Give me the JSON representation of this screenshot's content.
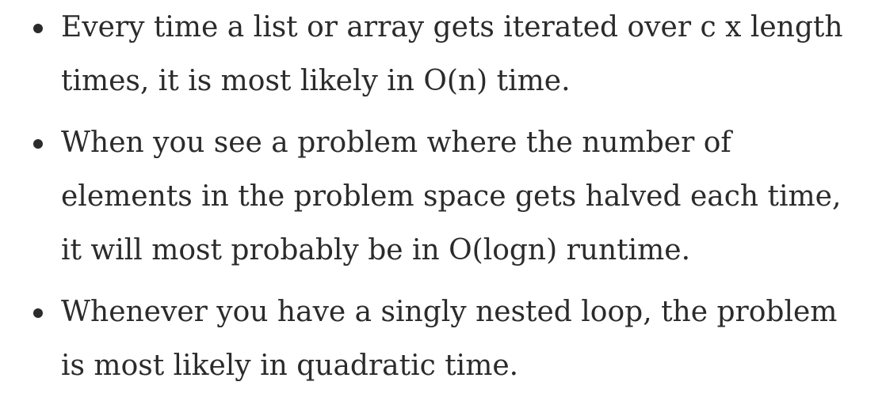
{
  "bullets": [
    {
      "lines": [
        "Every time a list or array gets iterated over c x length",
        "times, it is most likely in O(n) time."
      ]
    },
    {
      "lines": [
        "When you see a problem where the number of",
        "elements in the problem space gets halved each time,",
        "it will most probably be in O(logn) runtime."
      ]
    },
    {
      "lines": [
        "Whenever you have a singly nested loop, the problem",
        "is most likely in quadratic time."
      ]
    }
  ]
}
